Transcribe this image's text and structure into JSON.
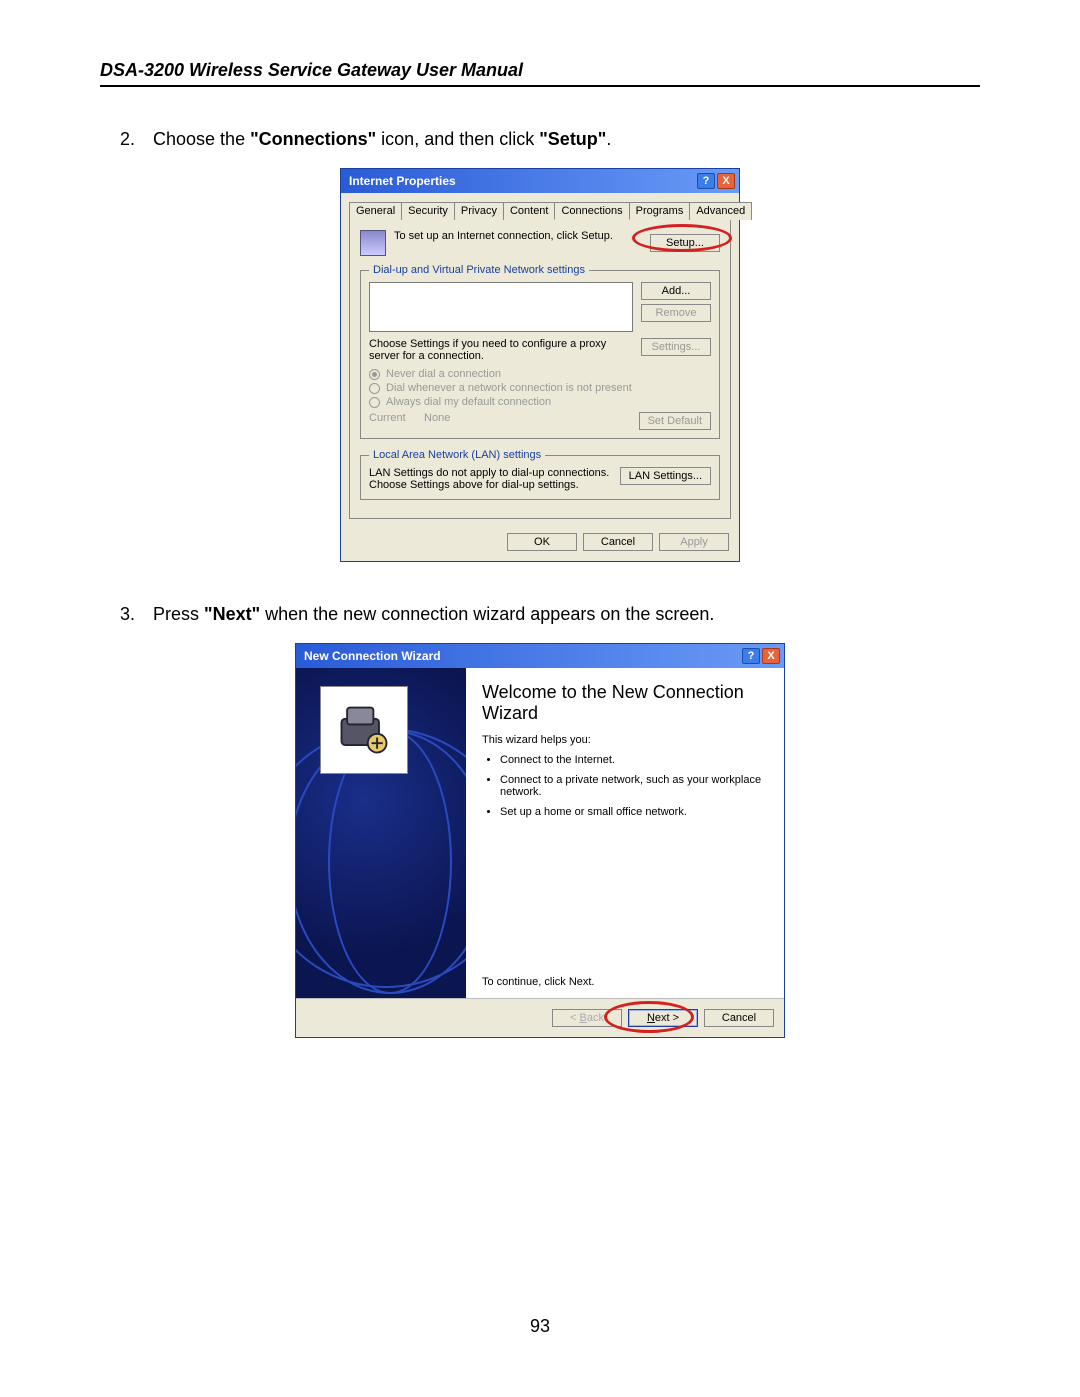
{
  "header": {
    "title": "DSA-3200 Wireless Service Gateway User Manual"
  },
  "page_number": "93",
  "steps": {
    "s2": {
      "num": "2.",
      "pre": "Choose the ",
      "b1": "\"Connections\"",
      "mid": " icon, and then click ",
      "b2": "\"Setup\"",
      "post": "."
    },
    "s3": {
      "num": "3.",
      "pre": "Press ",
      "b1": "\"Next\"",
      "post": " when the new connection wizard appears on the screen."
    }
  },
  "dlg1": {
    "title": "Internet Properties",
    "tabs": [
      "General",
      "Security",
      "Privacy",
      "Content",
      "Connections",
      "Programs",
      "Advanced"
    ],
    "active_tab_index": 4,
    "setup_text": "To set up an Internet connection, click Setup.",
    "setup_btn": "Setup...",
    "fs_dial": {
      "legend": "Dial-up and Virtual Private Network settings",
      "add": "Add...",
      "remove": "Remove",
      "hint": "Choose Settings if you need to configure a proxy server for a connection.",
      "settings": "Settings...",
      "r1": "Never dial a connection",
      "r2": "Dial whenever a network connection is not present",
      "r3": "Always dial my default connection",
      "current_lbl": "Current",
      "current_val": "None",
      "set_default": "Set Default"
    },
    "fs_lan": {
      "legend": "Local Area Network (LAN) settings",
      "text": "LAN Settings do not apply to dial-up connections. Choose Settings above for dial-up settings.",
      "btn": "LAN Settings..."
    },
    "ok": "OK",
    "cancel": "Cancel",
    "apply": "Apply"
  },
  "dlg2": {
    "title": "New Connection Wizard",
    "heading": "Welcome to the New Connection Wizard",
    "intro": "This wizard helps you:",
    "bullets": [
      "Connect to the Internet.",
      "Connect to a private network, such as your workplace network.",
      "Set up a home or small office network."
    ],
    "continue": "To continue, click Next.",
    "back": "Back",
    "next": "Next >",
    "cancel": "Cancel"
  }
}
